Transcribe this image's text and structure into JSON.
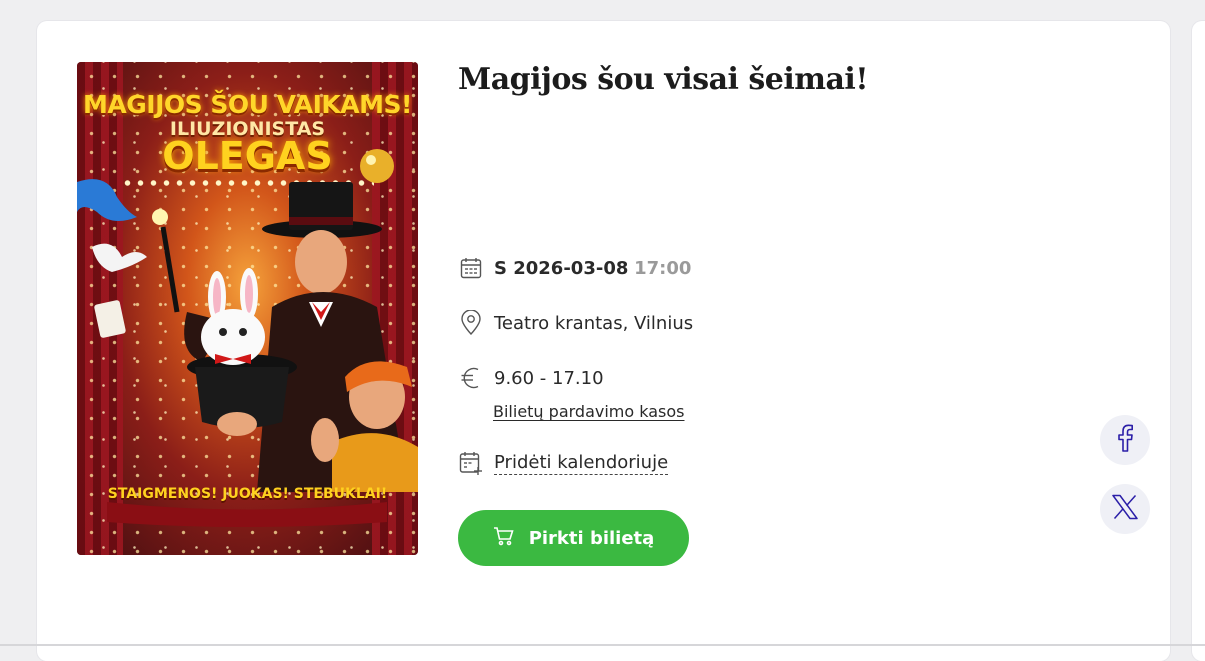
{
  "poster": {
    "alt": "Magijos šou vaikams poster",
    "line1": "MAGIJOS ŠOU VAIKAMS!",
    "line2": "ILIUZIONISTAS",
    "line3": "OLEGAS",
    "bottom": "STAIGMENOS! JUOKAS! STEBUKLAI!"
  },
  "event": {
    "title": "Magijos šou visai šeimai!",
    "date": "S 2026-03-08",
    "time": "17:00",
    "venue": "Teatro krantas, Vilnius",
    "price": "9.60 - 17.10",
    "ticket_offices_link": "Bilietų pardavimo kasos",
    "add_to_calendar": "Pridėti kalendoriuje",
    "buy_button": "Pirkti bilietą"
  },
  "share": {
    "facebook_icon": "facebook-icon",
    "x_icon": "x-twitter-icon"
  },
  "colors": {
    "buy_button": "#3bb941",
    "share_icon": "#2b1fa8",
    "share_bg": "#eff0f6"
  }
}
